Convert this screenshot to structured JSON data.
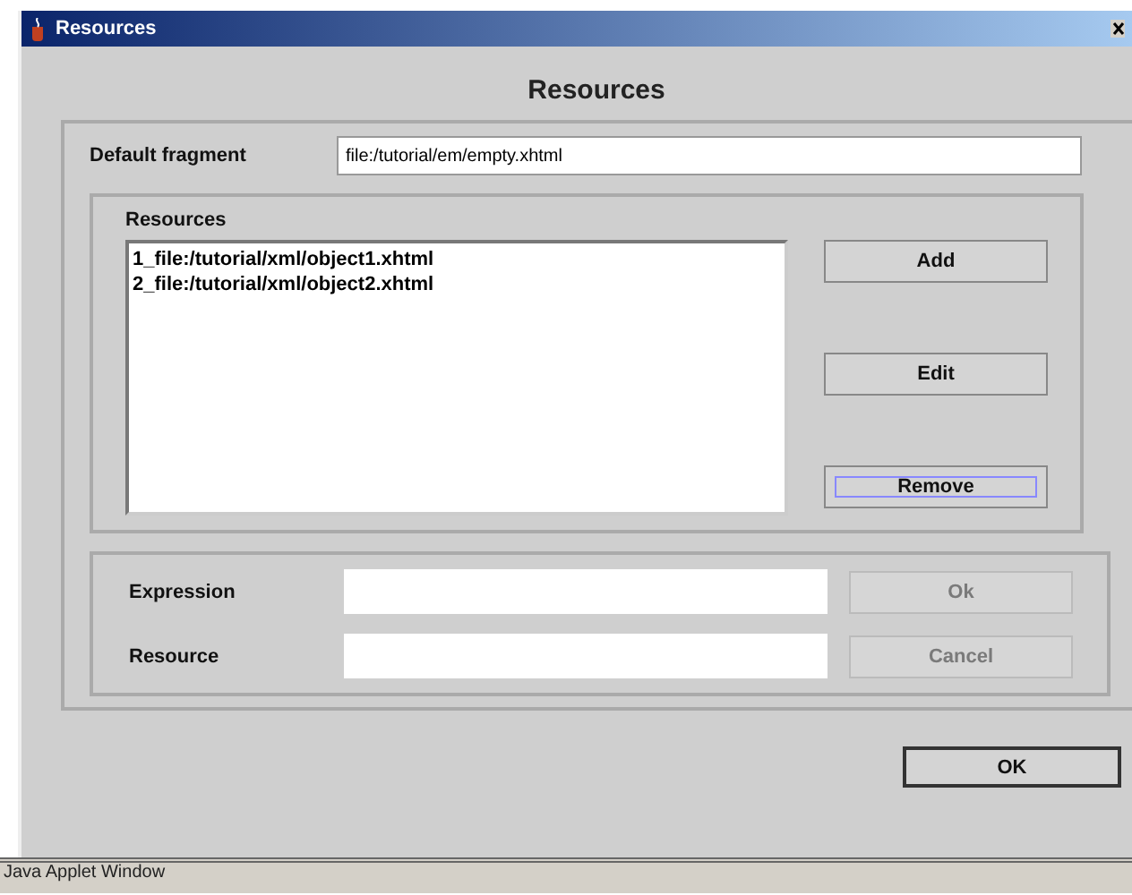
{
  "window": {
    "title": "Resources"
  },
  "heading": "Resources",
  "default_fragment": {
    "label": "Default fragment",
    "value": "file:/tutorial/em/empty.xhtml"
  },
  "resources": {
    "title": "Resources",
    "items": [
      "1_file:/tutorial/xml/object1.xhtml",
      "2_file:/tutorial/xml/object2.xhtml"
    ],
    "buttons": [
      {
        "label": "Add",
        "focused": false
      },
      {
        "label": "Edit",
        "focused": false
      },
      {
        "label": "Remove",
        "focused": true
      }
    ]
  },
  "editor": {
    "fields": [
      {
        "label": "Expression"
      },
      {
        "label": "Resource"
      }
    ],
    "buttons": [
      {
        "label": "Ok",
        "disabled": true
      },
      {
        "label": "Cancel",
        "disabled": true
      }
    ]
  },
  "ok_button": "OK",
  "status_bar": "Java Applet Window"
}
